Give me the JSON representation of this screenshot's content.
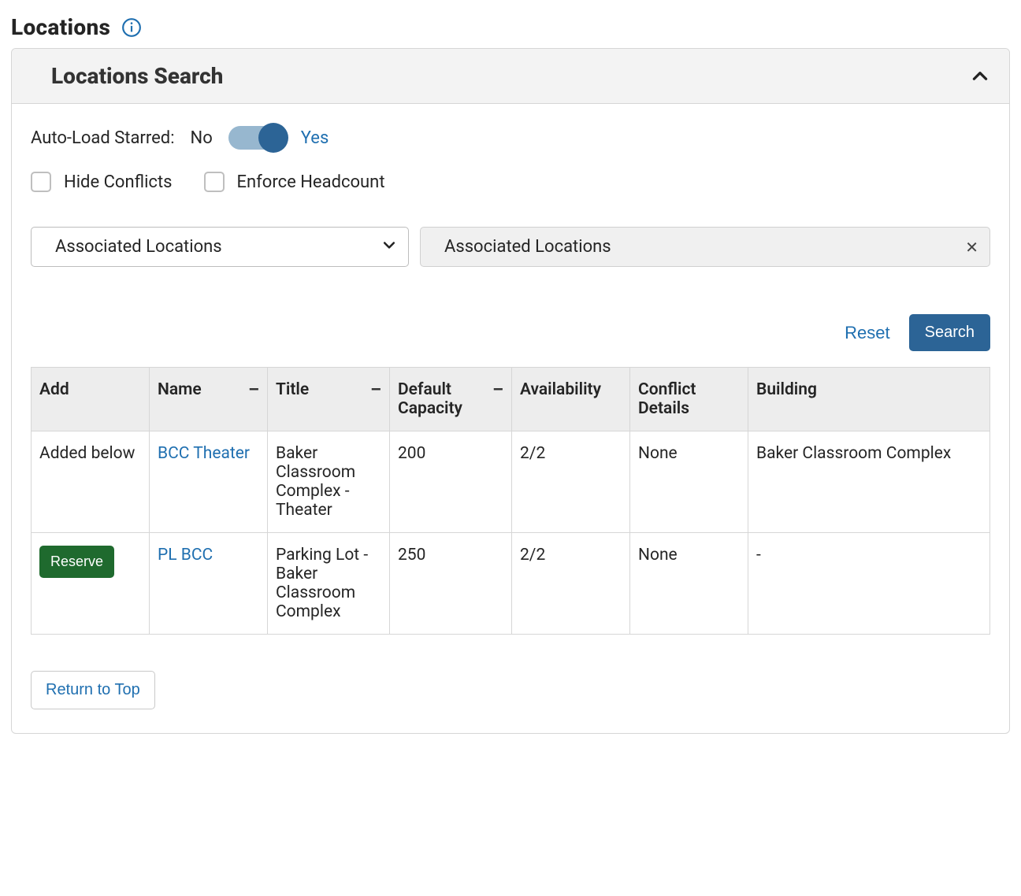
{
  "header": {
    "title": "Locations"
  },
  "panel": {
    "title": "Locations Search"
  },
  "autoload": {
    "label": "Auto-Load Starred:",
    "no": "No",
    "yes": "Yes",
    "value": true
  },
  "checks": {
    "hide_conflicts": "Hide Conflicts",
    "enforce_headcount": "Enforce Headcount"
  },
  "select": {
    "value": "Associated Locations"
  },
  "tag": {
    "label": "Associated Locations"
  },
  "actions": {
    "reset": "Reset",
    "search": "Search"
  },
  "table": {
    "columns": {
      "add": "Add",
      "name": "Name",
      "title": "Title",
      "capacity": "Default Capacity",
      "availability": "Availability",
      "conflict": "Conflict Details",
      "building": "Building"
    },
    "sort_glyph": "–",
    "rows": [
      {
        "add_label": "Added below",
        "add_type": "text",
        "name": "BCC Theater",
        "title": "Baker Classroom Complex - Theater",
        "capacity": "200",
        "availability": "2/2",
        "conflict": "None",
        "building": "Baker Classroom Complex"
      },
      {
        "add_label": "Reserve",
        "add_type": "button",
        "name": "PL BCC",
        "title": "Parking Lot - Baker Classroom Complex",
        "capacity": "250",
        "availability": "2/2",
        "conflict": "None",
        "building": "-"
      }
    ]
  },
  "footer": {
    "return_to_top": "Return to Top"
  }
}
